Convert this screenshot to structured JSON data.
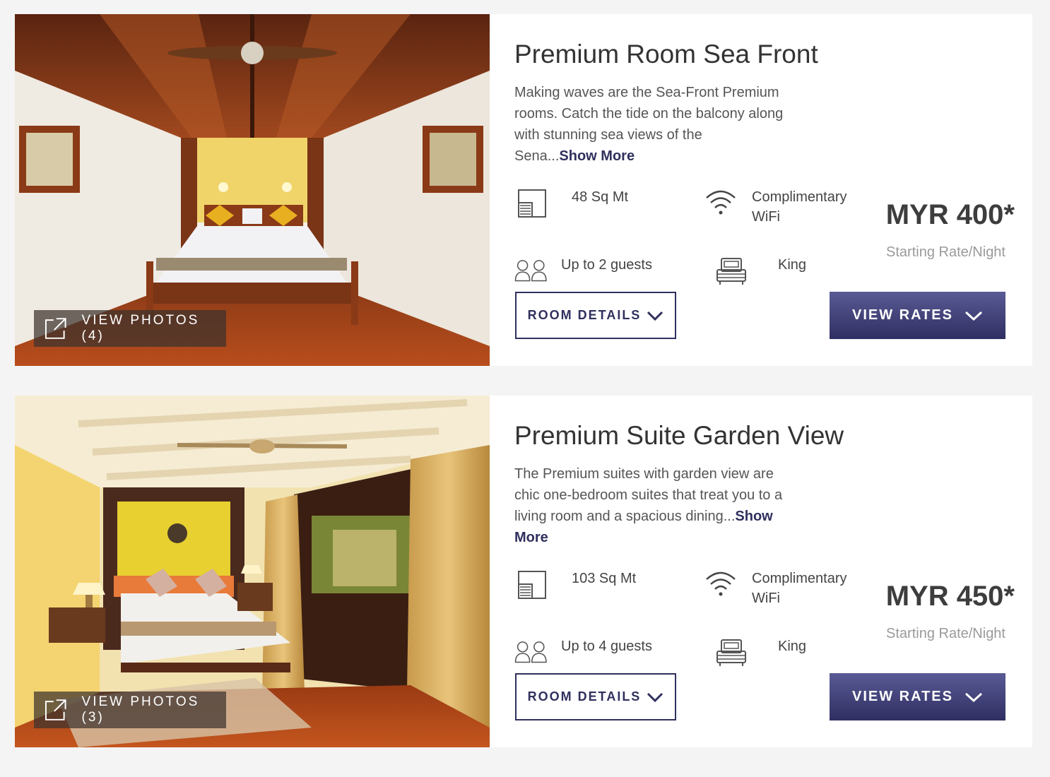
{
  "rooms": [
    {
      "title": "Premium Room Sea Front",
      "description": "Making waves are the Sea-Front Premium rooms. Catch the tide on the balcony along with stunning sea views of the Sena...",
      "show_more": "Show More",
      "size": "48 Sq Mt",
      "wifi": "Complimentary WiFi",
      "guests": "Up to 2 guests",
      "bed": "King",
      "price": "MYR 400*",
      "rate_caption": "Starting Rate/Night",
      "view_photos": "VIEW PHOTOS (4)",
      "room_details": "ROOM DETAILS",
      "view_rates": "VIEW RATES"
    },
    {
      "title": "Premium Suite Garden View",
      "description": "The Premium suites with garden view are chic one-bedroom suites that treat you to a living room and a spacious dining...",
      "show_more": "Show More",
      "size": "103 Sq Mt",
      "wifi": "Complimentary WiFi",
      "guests": "Up to 4 guests",
      "bed": "King",
      "price": "MYR 450*",
      "rate_caption": "Starting Rate/Night",
      "view_photos": "VIEW PHOTOS (3)",
      "room_details": "ROOM DETAILS",
      "view_rates": "VIEW RATES"
    }
  ],
  "icons": {
    "size": "floor-plan-icon",
    "wifi": "wifi-icon",
    "guests": "guests-icon",
    "bed": "bed-icon",
    "view_photos": "external-link-icon",
    "dropdown": "chevron-down-icon"
  },
  "colors": {
    "accent": "#30305e",
    "button_gradient_top": "#5a5a95",
    "button_gradient_bottom": "#2f2f62",
    "page_background": "#f4f4f4"
  }
}
